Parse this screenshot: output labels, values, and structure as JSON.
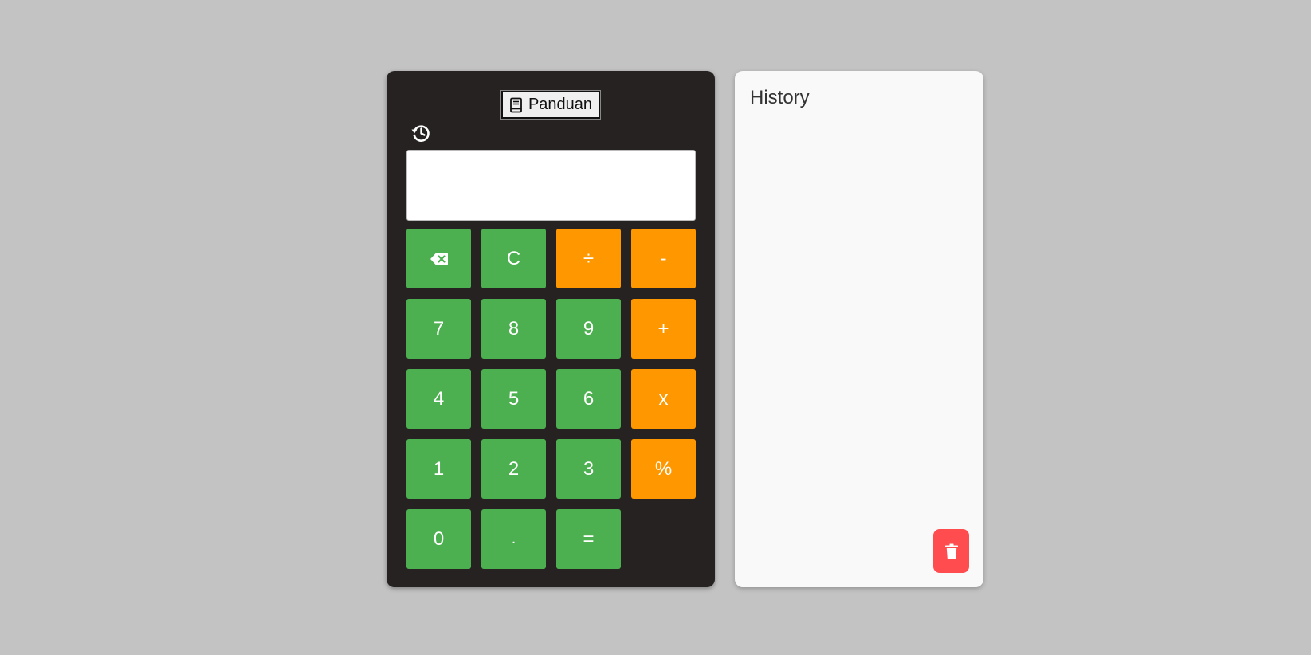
{
  "colors": {
    "page_background": "#c3c3c3",
    "calculator_body": "#262221",
    "number_key": "#4caf50",
    "operator_key": "#ff9800",
    "history_panel": "#f9f9f9",
    "delete_button": "#ff4d4f"
  },
  "calculator": {
    "guide_button": {
      "label": "Panduan",
      "icon": "book-icon"
    },
    "history_toggle_icon": "history-icon",
    "display": {
      "value": ""
    },
    "keys": [
      {
        "name": "backspace-button",
        "label": "",
        "icon": "backspace-icon",
        "style": "green"
      },
      {
        "name": "clear-button",
        "label": "C",
        "style": "green"
      },
      {
        "name": "divide-button",
        "label": "÷",
        "style": "orange"
      },
      {
        "name": "subtract-button",
        "label": "-",
        "style": "orange"
      },
      {
        "name": "key-7",
        "label": "7",
        "style": "green"
      },
      {
        "name": "key-8",
        "label": "8",
        "style": "green"
      },
      {
        "name": "key-9",
        "label": "9",
        "style": "green"
      },
      {
        "name": "add-button",
        "label": "+",
        "style": "orange"
      },
      {
        "name": "key-4",
        "label": "4",
        "style": "green"
      },
      {
        "name": "key-5",
        "label": "5",
        "style": "green"
      },
      {
        "name": "key-6",
        "label": "6",
        "style": "green"
      },
      {
        "name": "multiply-button",
        "label": "x",
        "style": "orange"
      },
      {
        "name": "key-1",
        "label": "1",
        "style": "green"
      },
      {
        "name": "key-2",
        "label": "2",
        "style": "green"
      },
      {
        "name": "key-3",
        "label": "3",
        "style": "green"
      },
      {
        "name": "percent-button",
        "label": "%",
        "style": "orange"
      },
      {
        "name": "key-0",
        "label": "0",
        "style": "green"
      },
      {
        "name": "decimal-button",
        "label": ".",
        "style": "green"
      },
      {
        "name": "equals-button",
        "label": "=",
        "style": "green"
      }
    ]
  },
  "history": {
    "title": "History",
    "entries": [],
    "clear_icon": "trash-icon"
  }
}
